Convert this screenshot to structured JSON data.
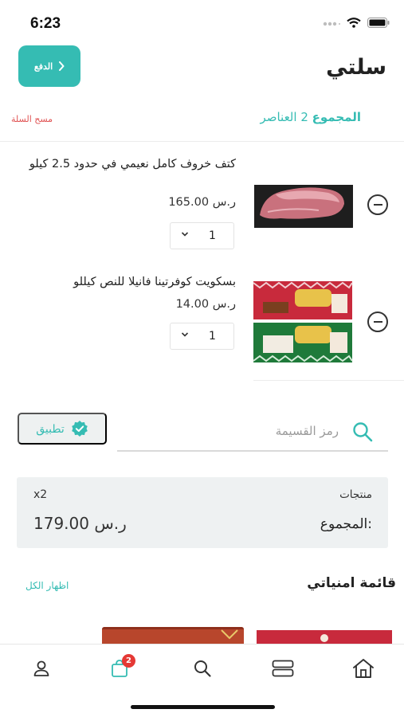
{
  "status_bar": {
    "time": "6:23"
  },
  "header": {
    "title": "سلتي",
    "pay_label": "الدفع"
  },
  "summary": {
    "total_label": "المجموع",
    "count_text": "2 العناصر",
    "clear_label": "مسح السلة"
  },
  "cart": {
    "items": [
      {
        "name": "كتف خروف كامل نعيمي في حدود 2.5 كيلو",
        "price": "165.00",
        "currency": "ر.س",
        "quantity": "1"
      },
      {
        "name": "بسكويت كوفرتينا فانيلا للنص كيللو",
        "price": "14.00",
        "currency": "ر.س",
        "quantity": "1"
      }
    ]
  },
  "coupon": {
    "placeholder": "رمز القسيمة",
    "apply_label": "تطبيق"
  },
  "totals": {
    "products_label": "منتجات",
    "products_count": "x2",
    "sum_label": "المجموع:",
    "sum_value": "179.00",
    "currency": "ر.س"
  },
  "wishlist": {
    "title": "قائمة امنياتي",
    "show_all": "اظهار الكل"
  },
  "tab_bar": {
    "cart_badge": "2"
  },
  "colors": {
    "accent": "#35bcb3",
    "danger": "#e05252",
    "badge": "#e53935",
    "card_bg": "#eef1f2"
  },
  "icons": [
    "signal-icon",
    "wifi-icon",
    "battery-icon",
    "chevron-left-icon",
    "minus-circle-icon",
    "chevron-down-icon",
    "search-icon",
    "verified-check-icon",
    "user-icon",
    "shopping-bag-icon",
    "categories-icon",
    "home-icon"
  ]
}
